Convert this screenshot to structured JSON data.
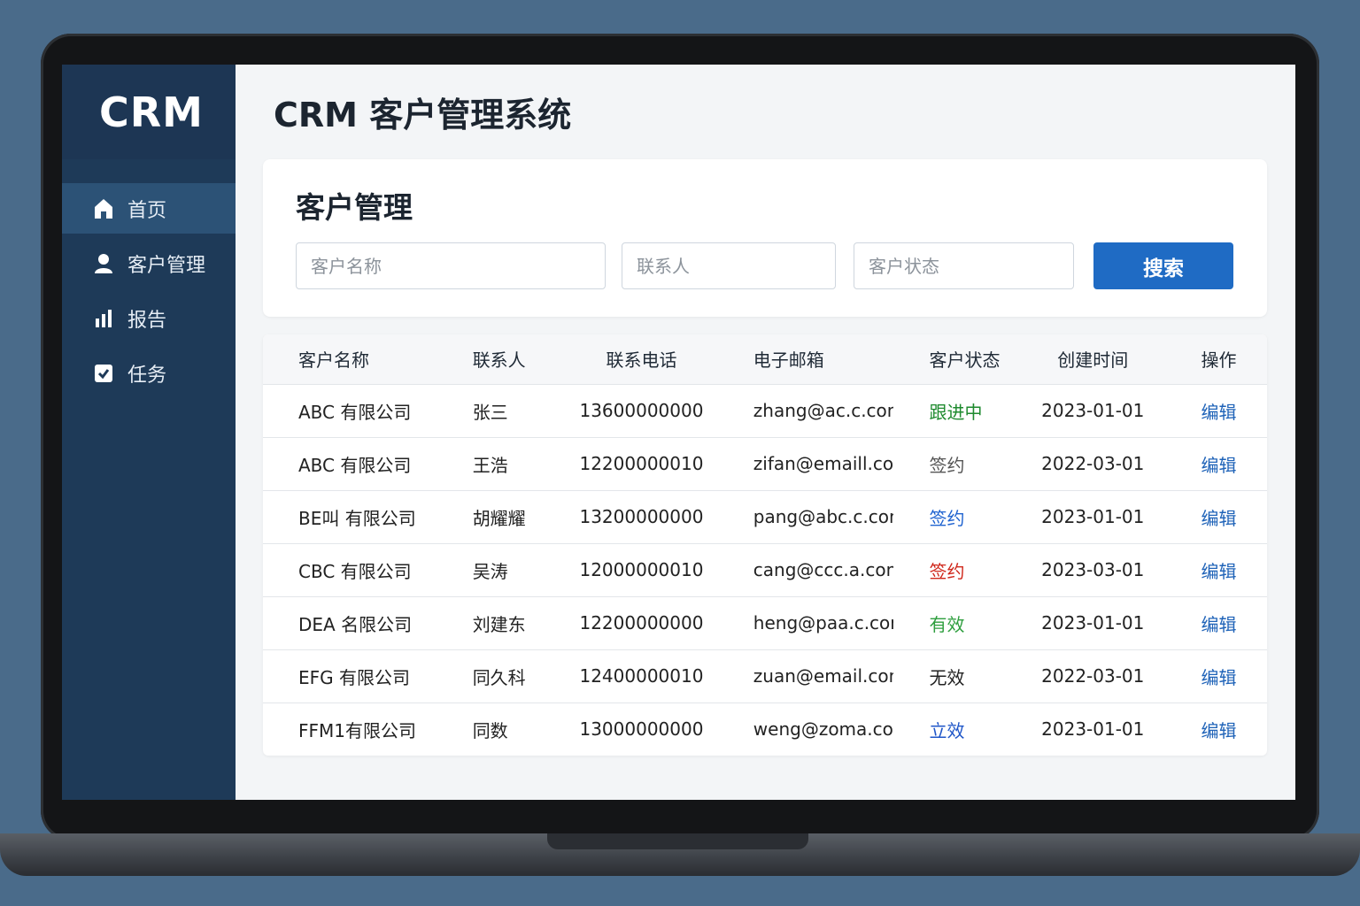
{
  "sidebar": {
    "brand": "CRM",
    "items": [
      {
        "label": "首页",
        "icon": "home-icon",
        "active": true
      },
      {
        "label": "客户管理",
        "icon": "user-icon",
        "active": false
      },
      {
        "label": "报告",
        "icon": "bar-chart-icon",
        "active": false
      },
      {
        "label": "任务",
        "icon": "checkbox-icon",
        "active": false
      }
    ]
  },
  "header": {
    "title": "CRM 客户管理系统"
  },
  "panel": {
    "title": "客户管理",
    "filters": {
      "name_placeholder": "客户名称",
      "contact_placeholder": "联系人",
      "status_placeholder": "客户状态"
    },
    "search_label": "搜索"
  },
  "table": {
    "columns": [
      "客户名称",
      "联系人",
      "联系电话",
      "电子邮箱",
      "客户状态",
      "创建时间",
      "操作"
    ],
    "rows": [
      {
        "name": "ABC 有限公司",
        "contact": "张三",
        "phone": "13600000000",
        "email": "zhang@ac.c.com",
        "status": "跟进中",
        "status_color": "#1e8a2e",
        "created": "2023-01-01",
        "action": "编辑"
      },
      {
        "name": "ABC 有限公司",
        "contact": "王浩",
        "phone": "12200000010",
        "email": "zifan@emaill.com",
        "status": "签约",
        "status_color": "#555555",
        "created": "2022-03-01",
        "action": "编辑"
      },
      {
        "name": "BE叫 有限公司",
        "contact": "胡耀耀",
        "phone": "13200000000",
        "email": "pang@abc.c.com",
        "status": "签约",
        "status_color": "#1f63d0",
        "created": "2023-01-01",
        "action": "编辑"
      },
      {
        "name": "CBC 有限公司",
        "contact": "吴涛",
        "phone": "12000000010",
        "email": "cang@ccc.a.com",
        "status": "签约",
        "status_color": "#d0281c",
        "created": "2023-03-01",
        "action": "编辑"
      },
      {
        "name": "DEA 名限公司",
        "contact": "刘建东",
        "phone": "12200000000",
        "email": "heng@paa.c.com",
        "status": "有效",
        "status_color": "#2e9e3e",
        "created": "2023-01-01",
        "action": "编辑"
      },
      {
        "name": "EFG 有限公司",
        "contact": "同久科",
        "phone": "12400000010",
        "email": "zuan@email.com",
        "status": "无效",
        "status_color": "#222222",
        "created": "2022-03-01",
        "action": "编辑"
      },
      {
        "name": "FFM1有限公司",
        "contact": "同数",
        "phone": "13000000000",
        "email": "weng@zoma.com",
        "status": "立效",
        "status_color": "#1f56c8",
        "created": "2023-01-01",
        "action": "编辑"
      }
    ]
  }
}
